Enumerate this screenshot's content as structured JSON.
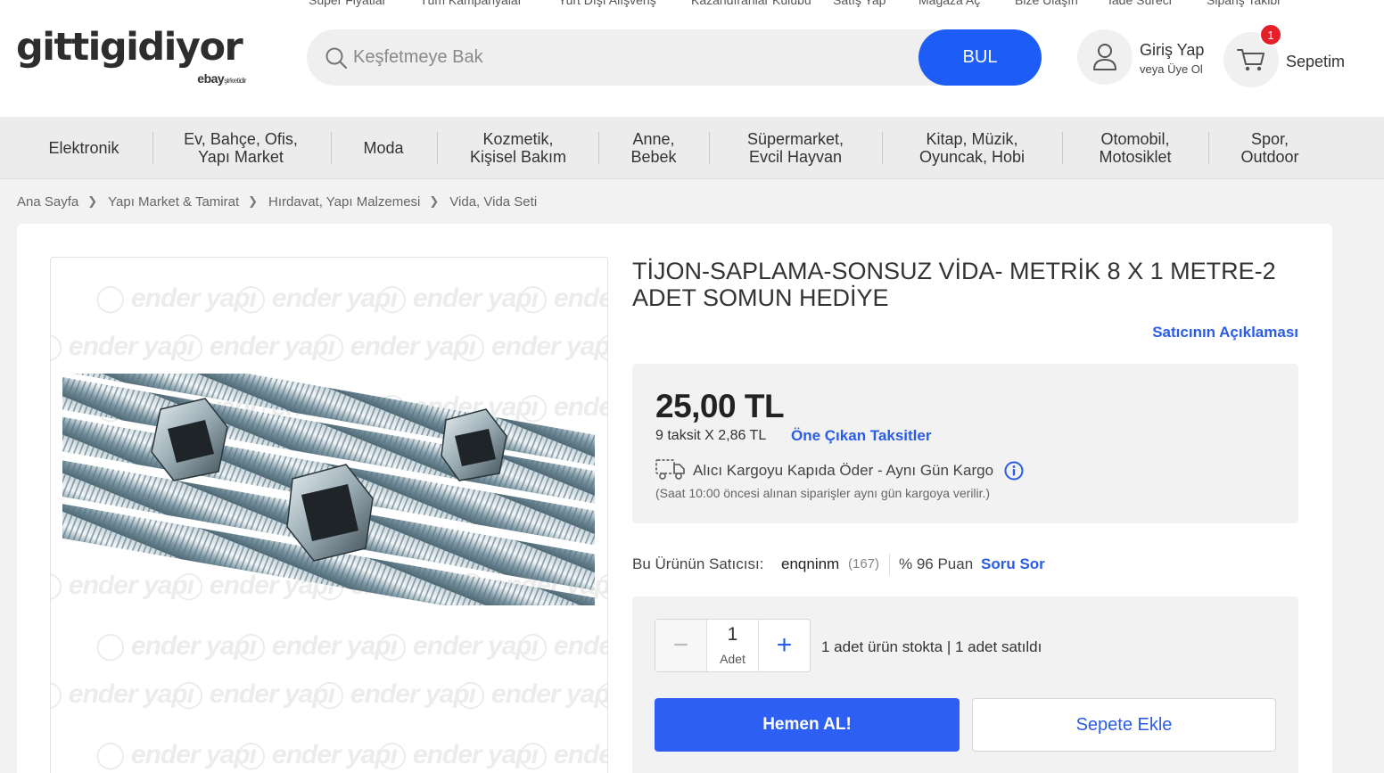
{
  "top_links": [
    "Süper Fiyatlar",
    "Tüm Kampanyalar",
    "Yurt Dışı Alışveriş",
    "Kazandıranlar Kulübü",
    "Satış Yap",
    "Mağaza Aç",
    "Bize Ulaşın",
    "İade Süreci",
    "Sipariş Takibi"
  ],
  "logo": {
    "text": "gittigidiyor",
    "sub_brand": "ebay",
    "sub_note": "şirketidir"
  },
  "search": {
    "placeholder": "Keşfetmeye Bak",
    "button": "BUL"
  },
  "user": {
    "login": "Giriş Yap",
    "register": "veya Üye Ol"
  },
  "cart": {
    "label": "Sepetim",
    "count": "1"
  },
  "nav": [
    {
      "line1": "Elektronik",
      "line2": ""
    },
    {
      "line1": "Ev, Bahçe, Ofis,",
      "line2": "Yapı Market"
    },
    {
      "line1": "Moda",
      "line2": ""
    },
    {
      "line1": "Kozmetik,",
      "line2": "Kişisel Bakım"
    },
    {
      "line1": "Anne,",
      "line2": "Bebek"
    },
    {
      "line1": "Süpermarket,",
      "line2": "Evcil Hayvan"
    },
    {
      "line1": "Kitap, Müzik,",
      "line2": "Oyuncak, Hobi"
    },
    {
      "line1": "Otomobil,",
      "line2": "Motosiklet"
    },
    {
      "line1": "Spor,",
      "line2": "Outdoor"
    }
  ],
  "breadcrumb": [
    "Ana Sayfa",
    "Yapı Market & Tamirat",
    "Hırdavat, Yapı Malzemesi",
    "Vida, Vida Seti"
  ],
  "product": {
    "title": "TİJON-SAPLAMA-SONSUZ VİDA- METRİK 8 X 1 METRE-2 ADET SOMUN HEDİYE",
    "seller_description_link": "Satıcının Açıklaması",
    "watermark": "ender yapı",
    "price": "25,00 TL",
    "installment": "9 taksit X 2,86 TL",
    "installment_link": "Öne Çıkan Taksitler",
    "shipping": "Alıcı Kargoyu Kapıda Öder - Aynı Gün Kargo",
    "shipping_note": "(Saat 10:00 öncesi alınan siparişler aynı gün kargoya verilir.)",
    "seller_label": "Bu Ürünün Satıcısı:",
    "seller_name": "enqninm",
    "seller_count": "(167)",
    "seller_score": "% 96 Puan",
    "ask_link": "Soru Sor",
    "quantity": "1",
    "quantity_unit": "Adet",
    "stock_info": "1 adet ürün stokta | 1 adet satıldı",
    "buy_now": "Hemen AL!",
    "add_to_cart": "Sepete Ekle"
  },
  "colors": {
    "primary": "#1d5cf5",
    "link": "#2b5ce6",
    "badge": "#e61e28"
  }
}
